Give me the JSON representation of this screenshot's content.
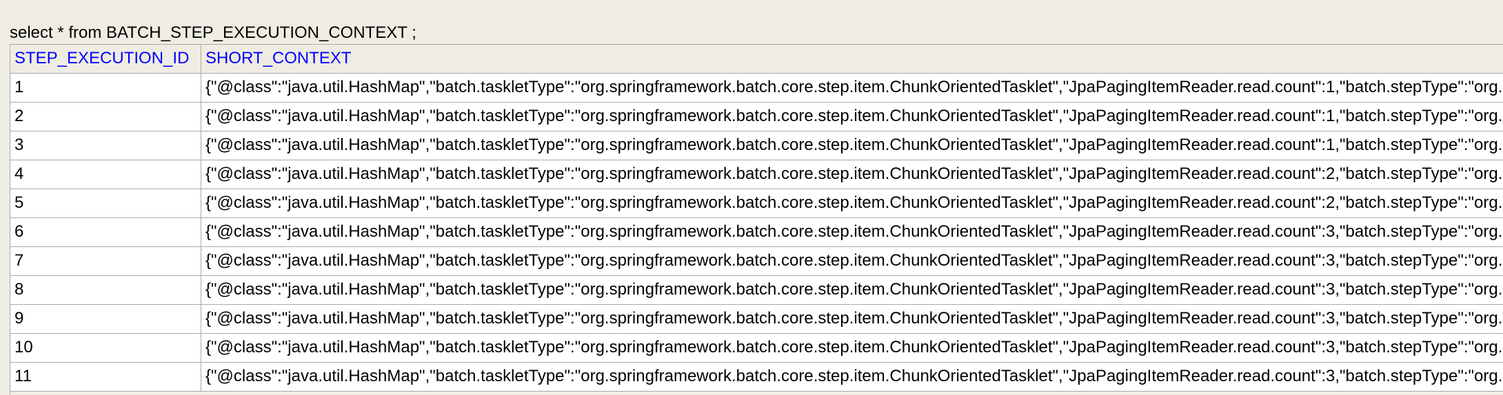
{
  "query": "select * from BATCH_STEP_EXECUTION_CONTEXT ;",
  "table": {
    "columns": [
      "STEP_EXECUTION_ID",
      "SHORT_CONTEXT"
    ],
    "rows": [
      {
        "id": "1",
        "ctx": "{\"@class\":\"java.util.HashMap\",\"batch.taskletType\":\"org.springframework.batch.core.step.item.ChunkOrientedTasklet\",\"JpaPagingItemReader.read.count\":1,\"batch.stepType\":\"org.s"
      },
      {
        "id": "2",
        "ctx": "{\"@class\":\"java.util.HashMap\",\"batch.taskletType\":\"org.springframework.batch.core.step.item.ChunkOrientedTasklet\",\"JpaPagingItemReader.read.count\":1,\"batch.stepType\":\"org.s"
      },
      {
        "id": "3",
        "ctx": "{\"@class\":\"java.util.HashMap\",\"batch.taskletType\":\"org.springframework.batch.core.step.item.ChunkOrientedTasklet\",\"JpaPagingItemReader.read.count\":1,\"batch.stepType\":\"org.s"
      },
      {
        "id": "4",
        "ctx": "{\"@class\":\"java.util.HashMap\",\"batch.taskletType\":\"org.springframework.batch.core.step.item.ChunkOrientedTasklet\",\"JpaPagingItemReader.read.count\":2,\"batch.stepType\":\"org.s"
      },
      {
        "id": "5",
        "ctx": "{\"@class\":\"java.util.HashMap\",\"batch.taskletType\":\"org.springframework.batch.core.step.item.ChunkOrientedTasklet\",\"JpaPagingItemReader.read.count\":2,\"batch.stepType\":\"org.s"
      },
      {
        "id": "6",
        "ctx": "{\"@class\":\"java.util.HashMap\",\"batch.taskletType\":\"org.springframework.batch.core.step.item.ChunkOrientedTasklet\",\"JpaPagingItemReader.read.count\":3,\"batch.stepType\":\"org.s"
      },
      {
        "id": "7",
        "ctx": "{\"@class\":\"java.util.HashMap\",\"batch.taskletType\":\"org.springframework.batch.core.step.item.ChunkOrientedTasklet\",\"JpaPagingItemReader.read.count\":3,\"batch.stepType\":\"org.s"
      },
      {
        "id": "8",
        "ctx": "{\"@class\":\"java.util.HashMap\",\"batch.taskletType\":\"org.springframework.batch.core.step.item.ChunkOrientedTasklet\",\"JpaPagingItemReader.read.count\":3,\"batch.stepType\":\"org.s"
      },
      {
        "id": "9",
        "ctx": "{\"@class\":\"java.util.HashMap\",\"batch.taskletType\":\"org.springframework.batch.core.step.item.ChunkOrientedTasklet\",\"JpaPagingItemReader.read.count\":3,\"batch.stepType\":\"org.s"
      },
      {
        "id": "10",
        "ctx": "{\"@class\":\"java.util.HashMap\",\"batch.taskletType\":\"org.springframework.batch.core.step.item.ChunkOrientedTasklet\",\"JpaPagingItemReader.read.count\":3,\"batch.stepType\":\"org.s"
      },
      {
        "id": "11",
        "ctx": "{\"@class\":\"java.util.HashMap\",\"batch.taskletType\":\"org.springframework.batch.core.step.item.ChunkOrientedTasklet\",\"JpaPagingItemReader.read.count\":3,\"batch.stepType\":\"org.s"
      }
    ]
  },
  "colors": {
    "background": "#efede3",
    "header_text": "#0000ff",
    "grid_line": "#a9a9a9",
    "cell_background": "#ffffff"
  }
}
